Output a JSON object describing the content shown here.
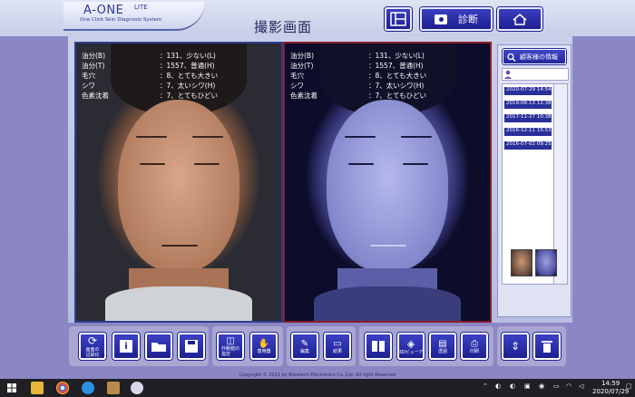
{
  "header": {
    "logo": "A-ONE",
    "logo_suffix": "LITE",
    "logo_sub": "One Click Skin Diagnosis System",
    "title": "撮影画面",
    "diagnosis_button": "診断"
  },
  "photos": {
    "overlay": [
      {
        "label": "油分(B)",
        "value": "：131、少ない(L)"
      },
      {
        "label": "油分(T)",
        "value": "：1557、普通(H)"
      },
      {
        "label": "毛穴",
        "value": "：8、とても大きい"
      },
      {
        "label": "シワ",
        "value": "：7、太いシワ(H)"
      },
      {
        "label": "色素沈着",
        "value": "：7、とてもひどい"
      }
    ]
  },
  "customer": {
    "info_button": "顧客様の情報",
    "history": [
      "2020-07-29 14:54",
      "2019-06-13 12:38",
      "2017-11-27 10:38",
      "2016-12-11 15:53",
      "2016-07-02 09:25"
    ]
  },
  "toolbar": {
    "groups": [
      {
        "buttons": [
          {
            "icon": "refresh-icon",
            "label": "画面の\n記録化"
          },
          {
            "icon": "info-icon",
            "label": ""
          },
          {
            "icon": "folder-icon",
            "label": ""
          },
          {
            "icon": "save-icon",
            "label": ""
          }
        ]
      },
      {
        "buttons": [
          {
            "icon": "mirror-icon",
            "label": "外観値の\n指定"
          },
          {
            "icon": "hand-icon",
            "label": "専用器"
          }
        ]
      },
      {
        "buttons": [
          {
            "icon": "edit-icon",
            "label": "編集"
          },
          {
            "icon": "monitor-icon",
            "label": "結果"
          }
        ]
      },
      {
        "buttons": [
          {
            "icon": "book-icon",
            "label": ""
          },
          {
            "icon": "cube-icon",
            "label": "3Dビューア"
          },
          {
            "icon": "clipboard-icon",
            "label": "透過"
          },
          {
            "icon": "print-icon",
            "label": "印刷"
          }
        ]
      },
      {
        "buttons": [
          {
            "icon": "zoom-icon",
            "label": ""
          },
          {
            "icon": "trash-icon",
            "label": ""
          }
        ]
      }
    ]
  },
  "footer": {
    "copyright": "Copyright © 2011 by Boretech Electronics Co.,Ltd. All right Reserved"
  },
  "taskbar": {
    "time": "14:59",
    "date": "2020/07/29"
  },
  "colors": {
    "background": "#8b86c4",
    "button_blue": "#2a2f9a",
    "left_frame": "#2e3e8e",
    "right_frame": "#8a1d2b"
  }
}
